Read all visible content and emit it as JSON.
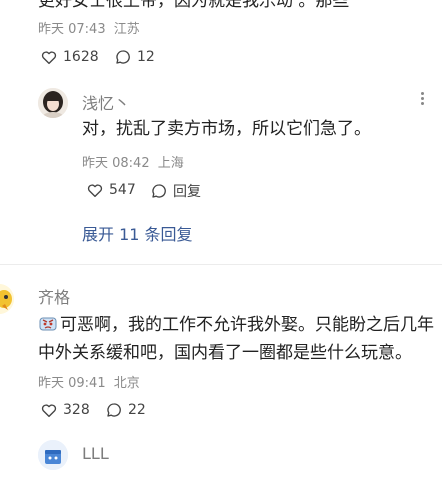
{
  "comment1": {
    "body_cut": "更好女士很上帝，因为就是我乐动 。那些",
    "time": "昨天 07:43",
    "location": "江苏",
    "likes": "1628",
    "replies": "12"
  },
  "reply1": {
    "username": "浅忆丶",
    "text": "对，扰乱了卖方市场，所以它们急了。",
    "time": "昨天 08:42",
    "location": "上海",
    "likes": "547",
    "reply_label": "回复"
  },
  "expand_label": "展开 11 条回复",
  "comment2": {
    "username": "齐格",
    "line1": "可恶啊，我的工作不允许我外娶。只能盼之后几年",
    "line2": "中外关系缓和吧，国内看了一圈都是些什么玩意。",
    "time": "昨天 09:41",
    "location": "北京",
    "likes": "328",
    "replies": "22"
  },
  "reply2": {
    "username": "LLL"
  },
  "colors": {
    "link": "#3a5a95",
    "meta": "#8a8a8a",
    "text": "#222222"
  }
}
